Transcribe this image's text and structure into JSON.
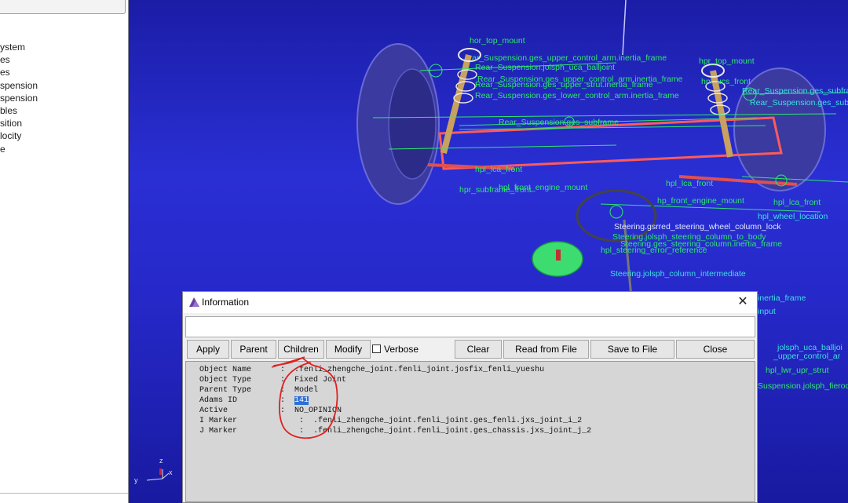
{
  "left_panel": {
    "tree_items": [
      "ystem",
      "",
      "es",
      "es",
      "",
      "spension",
      "spension",
      "bles",
      "sition",
      "locity",
      "e"
    ]
  },
  "viewport": {
    "labels": [
      {
        "text": "hor_top_mount",
        "cls": "green"
      },
      {
        "text": "ar_Suspension.ges_upper_control_arm.inertia_frame",
        "cls": "green"
      },
      {
        "text": "Rear_Suspension.jolsph_uca_balljoint",
        "cls": "green"
      },
      {
        "text": "Rear_Suspension.ges_upper_control_arm.inertia_frame",
        "cls": "green"
      },
      {
        "text": "Rear_Suspension.ges_upper_strut.inertia_frame",
        "cls": "green"
      },
      {
        "text": "Rear_Suspension.ges_lower_control_arm.inertia_frame",
        "cls": "green"
      },
      {
        "text": "Rear_Suspension.ges_subframe",
        "cls": "green"
      },
      {
        "text": "hpl_lca_front",
        "cls": "green"
      },
      {
        "text": "hpr_subframe_front",
        "cls": "green"
      },
      {
        "text": "hpl_front_engine_mount",
        "cls": "green"
      },
      {
        "text": "hpl_lca_front",
        "cls": "green"
      },
      {
        "text": "hp_front_engine_mount",
        "cls": "green"
      },
      {
        "text": "hpl_lca_front",
        "cls": "green"
      },
      {
        "text": "Steering.gsrred_steering_wheel_column_lock",
        "cls": "white"
      },
      {
        "text": "Steering.jolsph_steering_column_to_body",
        "cls": "green"
      },
      {
        "text": "Steering.ges_steering_column.inertia_frame",
        "cls": "green"
      },
      {
        "text": "hpl_steering_error_reference",
        "cls": "green"
      },
      {
        "text": "Steering.jolsph_column_intermediate",
        "cls": "cyan"
      },
      {
        "text": "inertia_frame",
        "cls": "cyan"
      },
      {
        "text": "input",
        "cls": "cyan"
      },
      {
        "text": "jolsph_uca_balljoi",
        "cls": "cyan"
      },
      {
        "text": "_upper_control_ar",
        "cls": "cyan"
      },
      {
        "text": "hpl_lwr_upr_strut",
        "cls": "green"
      },
      {
        "text": "Suspension.jolsph_fierod",
        "cls": "green"
      },
      {
        "text": "hpl_wheel_location",
        "cls": "cyan"
      },
      {
        "text": "hpr_top_mount",
        "cls": "green"
      },
      {
        "text": "hpl_ucs_front",
        "cls": "green"
      },
      {
        "text": "Rear_Suspension.ges_subframe",
        "cls": "cyan"
      },
      {
        "text": "Rear_Suspension.ges_subframe.upperstr",
        "cls": "cyan"
      }
    ],
    "triad": {
      "x": "x",
      "y": "y",
      "z": "z"
    }
  },
  "dialog": {
    "title": "Information",
    "close_glyph": "✕",
    "query_value": "",
    "buttons": {
      "apply": "Apply",
      "parent": "Parent",
      "children": "Children",
      "modify": "Modify",
      "verbose": "Verbose",
      "clear": "Clear",
      "read_from_file": "Read from File",
      "save_to_file": "Save to File",
      "close": "Close"
    },
    "verbose_checked": false,
    "output": {
      "object_name_key": "Object Name",
      "object_name": ".fenli_zhengche_joint.fenli_joint.josfix_fenli_yueshu",
      "object_type_key": "Object Type",
      "object_type": "Fixed Joint",
      "parent_type_key": "Parent Type",
      "parent_type": "Model",
      "adams_id_key": "Adams ID",
      "adams_id": "141",
      "active_key": "Active",
      "active": "NO_OPINION",
      "i_marker_key": "I Marker",
      "i_marker": ".fenli_zhengche_joint.fenli_joint.ges_fenli.jxs_joint_i_2",
      "j_marker_key": "J Marker",
      "j_marker": ".fenli_zhengche_joint.fenli_joint.ges_chassis.jxs_joint_j_2"
    }
  },
  "colors": {
    "viewport_blue": "#2628c8",
    "label_green": "#2ee86a",
    "label_cyan": "#3ce0e0",
    "annotation_red": "#e02020",
    "selection_blue": "#2f6fd6"
  }
}
